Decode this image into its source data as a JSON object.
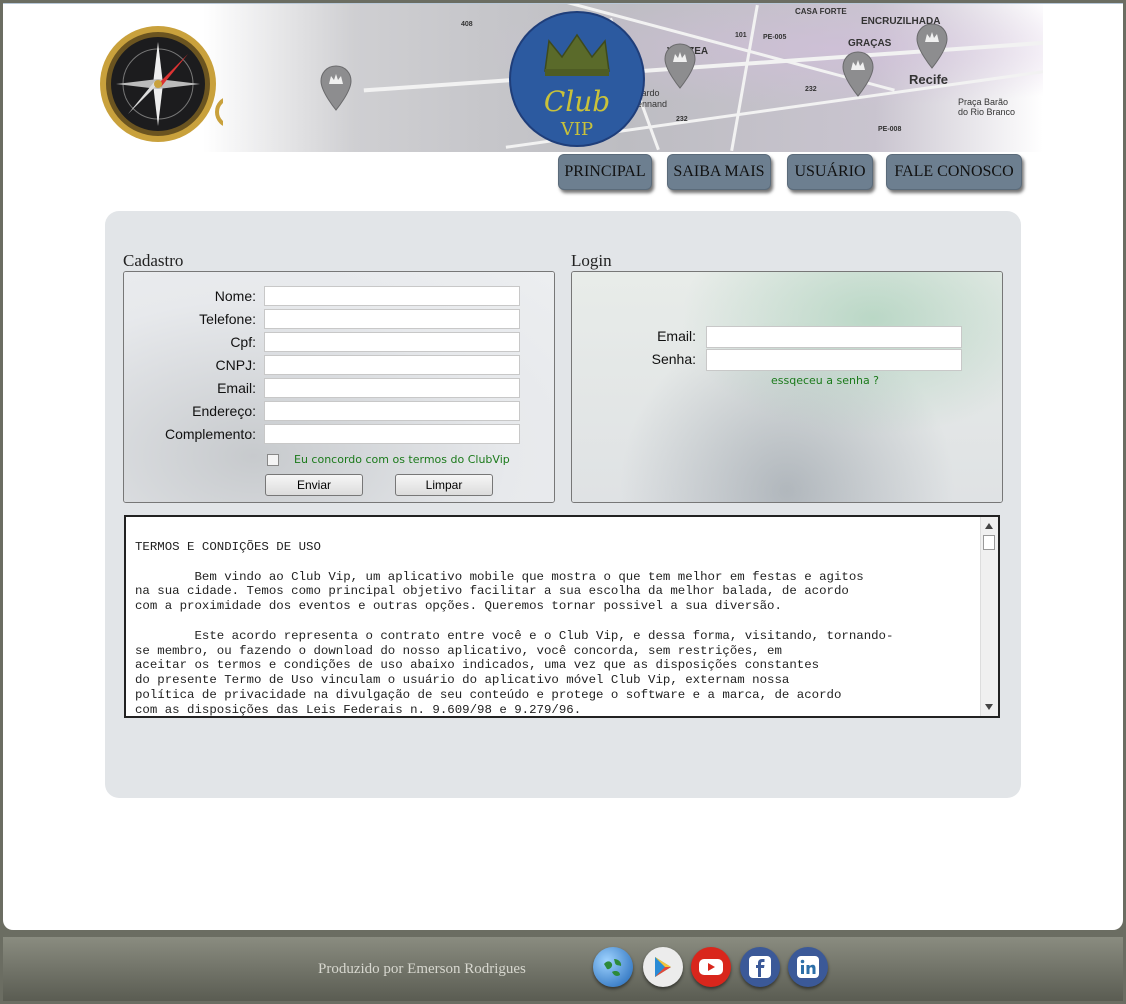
{
  "nav": {
    "items": [
      {
        "label": "PRINCIPAL"
      },
      {
        "label": "SAIBA MAIS"
      },
      {
        "label": "USUÁRIO"
      },
      {
        "label": "FALE CONOSCO"
      }
    ]
  },
  "header": {
    "map_labels": [
      "CASA FORTE",
      "ENCRUZILHADA",
      "VÁRZEA",
      "GRAÇAS",
      "Recife",
      "Praça Barão",
      "do Rio Branco",
      "PE-005",
      "PE-008",
      "101",
      "408",
      "232",
      "cardo",
      "ennand",
      "232"
    ],
    "logo_text": "Club",
    "logo_subtext": "VIP"
  },
  "cadastro": {
    "title": "Cadastro",
    "fields": [
      {
        "label": "Nome:",
        "value": ""
      },
      {
        "label": "Telefone:",
        "value": ""
      },
      {
        "label": "Cpf:",
        "value": ""
      },
      {
        "label": "CNPJ:",
        "value": ""
      },
      {
        "label": "Email:",
        "value": ""
      },
      {
        "label": "Endereço:",
        "value": ""
      },
      {
        "label": "Complemento:",
        "value": ""
      }
    ],
    "terms_checkbox_label": "Eu concordo com os termos do ClubVip",
    "terms_checked": false,
    "submit_label": "Enviar",
    "reset_label": "Limpar"
  },
  "login": {
    "title": "Login",
    "email_label": "Email:",
    "email_value": "",
    "password_label": "Senha:",
    "password_value": "",
    "forgot_label": "essqeceu a senha ?"
  },
  "terms": {
    "text": "TERMOS E CONDIÇÕES DE USO\n\n        Bem vindo ao Club Vip, um aplicativo mobile que mostra o que tem melhor em festas e agitos\nna sua cidade. Temos como principal objetivo facilitar a sua escolha da melhor balada, de acordo\ncom a proximidade dos eventos e outras opções. Queremos tornar possivel a sua diversão.\n\n        Este acordo representa o contrato entre você e o Club Vip, e dessa forma, visitando, tornando-\nse membro, ou fazendo o download do nosso aplicativo, você concorda, sem restrições, em\naceitar os termos e condições de uso abaixo indicados, uma vez que as disposições constantes\ndo presente Termo de Uso vinculam o usuário do aplicativo móvel Club Vip, externam nossa\npolítica de privacidade na divulgação de seu conteúdo e protege o software e a marca, de acordo\ncom as disposições das Leis Federais n. 9.609/98 e 9.279/96."
  },
  "footer": {
    "credit": "Produzido por Emerson Rodrigues",
    "social": [
      "globe-icon",
      "google-play-icon",
      "youtube-icon",
      "facebook-icon",
      "linkedin-icon"
    ]
  },
  "colors": {
    "panel": "#e2e5e8",
    "nav_button": "#6d7f90",
    "link_green": "#1b7a1b",
    "logo_blue": "#2c5aa0",
    "logo_gold": "#c9c23a"
  }
}
